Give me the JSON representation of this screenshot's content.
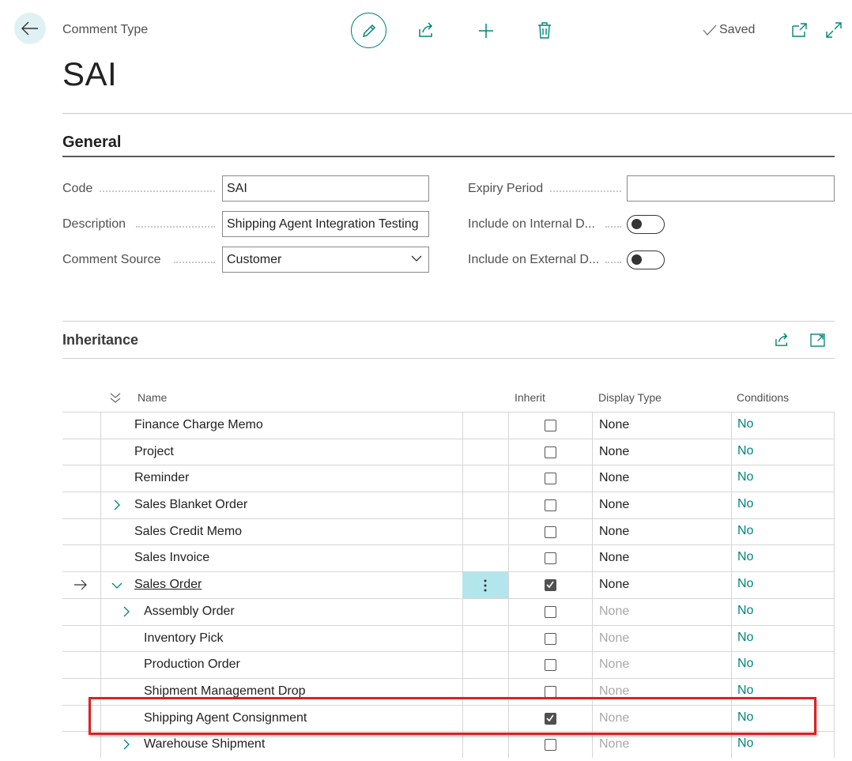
{
  "header": {
    "breadcrumb": "Comment Type",
    "title": "SAI",
    "saved_label": "Saved"
  },
  "general": {
    "section_title": "General",
    "fields": {
      "code_label": "Code",
      "code_value": "SAI",
      "description_label": "Description",
      "description_value": "Shipping Agent Integration Testing",
      "comment_source_label": "Comment Source",
      "comment_source_value": "Customer",
      "expiry_period_label": "Expiry Period",
      "expiry_period_value": "",
      "include_internal_label": "Include on Internal D...",
      "include_internal_value": false,
      "include_external_label": "Include on External D...",
      "include_external_value": false
    }
  },
  "inheritance": {
    "section_title": "Inheritance",
    "columns": {
      "name": "Name",
      "inherit": "Inherit",
      "display_type": "Display Type",
      "conditions": "Conditions"
    },
    "rows": [
      {
        "name": "Finance Charge Memo",
        "inherit": false,
        "display_type": "None",
        "conditions": "No",
        "dim": false
      },
      {
        "name": "Project",
        "inherit": false,
        "display_type": "None",
        "conditions": "No",
        "dim": false
      },
      {
        "name": "Reminder",
        "inherit": false,
        "display_type": "None",
        "conditions": "No",
        "dim": false
      },
      {
        "name": "Sales Blanket Order",
        "inherit": false,
        "display_type": "None",
        "conditions": "No",
        "dim": false
      },
      {
        "name": "Sales Credit Memo",
        "inherit": false,
        "display_type": "None",
        "conditions": "No",
        "dim": false
      },
      {
        "name": "Sales Invoice",
        "inherit": false,
        "display_type": "None",
        "conditions": "No",
        "dim": false
      },
      {
        "name": "Sales Order",
        "inherit": true,
        "display_type": "None",
        "conditions": "No",
        "dim": false
      },
      {
        "name": "Assembly Order",
        "inherit": false,
        "display_type": "None",
        "conditions": "No",
        "dim": true
      },
      {
        "name": "Inventory Pick",
        "inherit": false,
        "display_type": "None",
        "conditions": "No",
        "dim": true
      },
      {
        "name": "Production Order",
        "inherit": false,
        "display_type": "None",
        "conditions": "No",
        "dim": true
      },
      {
        "name": "Shipment Management Drop",
        "inherit": false,
        "display_type": "None",
        "conditions": "No",
        "dim": true
      },
      {
        "name": "Shipping Agent Consignment",
        "inherit": true,
        "display_type": "None",
        "conditions": "No",
        "dim": true
      },
      {
        "name": "Warehouse Shipment",
        "inherit": false,
        "display_type": "None",
        "conditions": "No",
        "dim": true
      }
    ]
  },
  "colors": {
    "accent": "#00857a",
    "selected_row_menu": "#b3e5ec",
    "highlight_border": "#e02020"
  }
}
